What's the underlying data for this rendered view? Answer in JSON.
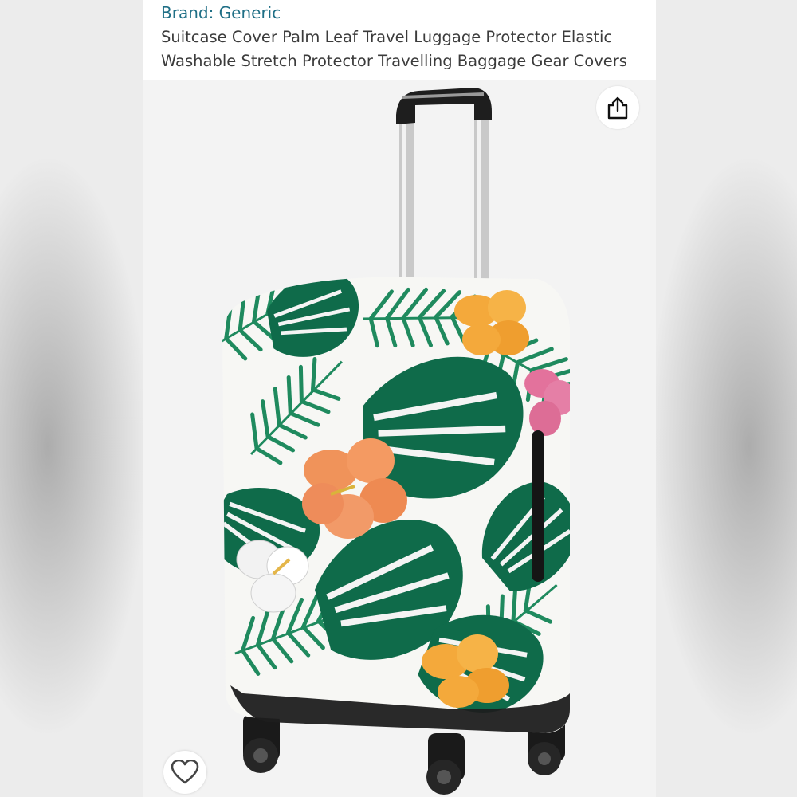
{
  "product": {
    "brand_label": "Brand: Generic",
    "title": "Suitcase Cover Palm Leaf Travel Luggage Protector Elastic Washable Stretch Protector Travelling Baggage Gear Covers"
  },
  "image": {
    "subject": "tropical palm leaf suitcase cover on rolling luggage",
    "share_icon": "share-icon",
    "favorite_icon": "heart-icon"
  },
  "colors": {
    "brand_link": "#1f6f86",
    "title_text": "#3b3b3b",
    "leaf_dark": "#0f6b4a",
    "leaf_light": "#2fa37a",
    "hibiscus_orange": "#f0935a",
    "hibiscus_yellow": "#f4a93b",
    "hibiscus_pink": "#e3729c"
  }
}
